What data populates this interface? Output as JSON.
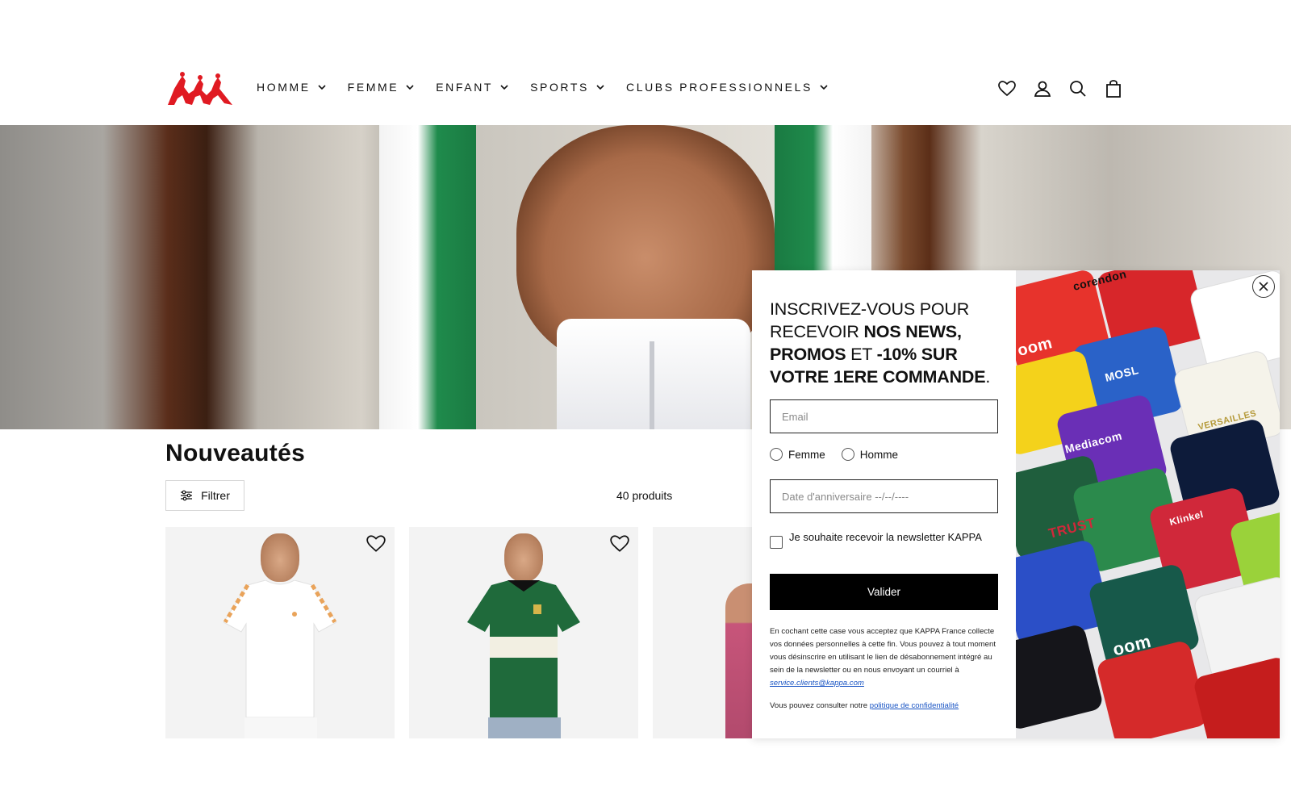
{
  "brand": {
    "name": "Kappa",
    "logo_color": "#e01a22"
  },
  "nav": {
    "items": [
      {
        "label": "HOMME"
      },
      {
        "label": "FEMME"
      },
      {
        "label": "ENFANT"
      },
      {
        "label": "SPORTS"
      },
      {
        "label": "CLUBS PROFESSIONNELS"
      }
    ]
  },
  "header_icons": [
    "heart-icon",
    "account-icon",
    "search-icon",
    "bag-icon"
  ],
  "collection": {
    "title": "Nouveautés",
    "filter_label": "Filtrer",
    "count_label": "40 produits"
  },
  "products": [
    {
      "shirt_color": "#ffffff",
      "trim_color": "#e9a35a"
    },
    {
      "shirt_color": "#1f6a3b",
      "trim_color": "#f2efe2"
    },
    {
      "shirt_color": "#c7557a",
      "trim_color": "#c7557a"
    }
  ],
  "popup": {
    "title_parts": [
      {
        "text": "INSCRIVEZ-VOUS POUR RECEVOIR ",
        "bold": false
      },
      {
        "text": "NOS NEWS, PROMOS",
        "bold": true
      },
      {
        "text": " ET ",
        "bold": false
      },
      {
        "text": "-10% SUR VOTRE 1ERE COMMANDE",
        "bold": true
      },
      {
        "text": ".",
        "bold": false
      }
    ],
    "email_placeholder": "Email",
    "gender_options": [
      "Femme",
      "Homme"
    ],
    "birthday_placeholder": "Date d'anniversaire --/--/----",
    "newsletter_checkbox_label": "Je souhaite recevoir la newsletter KAPPA",
    "submit_label": "Valider",
    "legal_text": "En cochant cette case vous acceptez que KAPPA France collecte vos données personnelles à cette fin. Vous pouvez à tout moment vous désinscrire en utilisant le lien de désabonnement intégré au sein de la newsletter ou en nous envoyant un courriel à ",
    "legal_email": "service.clients@kappa.com",
    "privacy_prefix": "Vous pouvez consulter notre ",
    "privacy_link": "politique de confidentialité",
    "jersey_labels": [
      "corendon",
      "MOSL",
      "Mediacom",
      "VERSAILLES",
      "Klinkel",
      "TRUST",
      "oom",
      "oom"
    ]
  }
}
